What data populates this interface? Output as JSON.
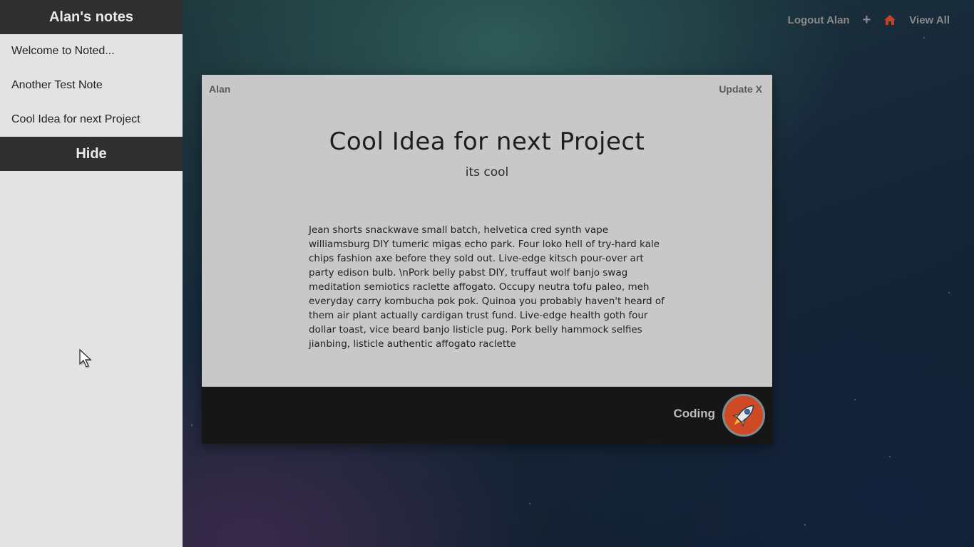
{
  "sidebar": {
    "title": "Alan's notes",
    "notes": [
      "Welcome to Noted...",
      "Another Test Note",
      "Cool Idea for next Project"
    ],
    "hide_label": "Hide"
  },
  "nav": {
    "logout_label": "Logout Alan",
    "add_icon": "plus-icon",
    "home_icon": "home-icon",
    "view_all_label": "View All",
    "home_color": "#c44420"
  },
  "note": {
    "author": "Alan",
    "update_label": "Update",
    "close_label": "X",
    "title": "Cool Idea for next Project",
    "subtitle": "its cool",
    "body": "Jean shorts snackwave small batch, helvetica cred synth vape williamsburg DIY tumeric migas echo park. Four loko hell of try-hard kale chips fashion axe before they sold out. Live-edge kitsch pour-over art party edison bulb. \\nPork belly pabst DIY, truffaut wolf banjo swag meditation semiotics raclette affogato. Occupy neutra tofu paleo, meh everyday carry kombucha pok pok. Quinoa you probably haven't heard of them air plant actually cardigan trust fund. Live-edge health goth four dollar toast, vice beard banjo listicle pug. Pork belly hammock selfies jianbing, listicle authentic affogato raclette",
    "category": "Coding",
    "category_icon": "rocket-icon",
    "category_color": "#cf4a24"
  }
}
